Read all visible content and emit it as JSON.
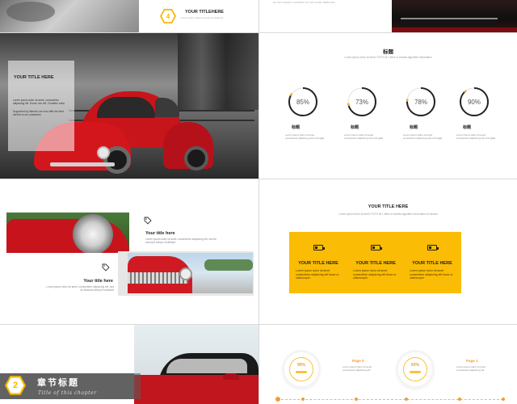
{
  "slide1": {
    "number": "4",
    "title": "YOUR TITLEHERE",
    "body": "Lorem ipsum dolor sit amet consectetur"
  },
  "slide2": {
    "body": "DO NOT MODIFY CONTENT IN THIS SLIDE TEMPLATE"
  },
  "slide3": {
    "title": "YOUR TITLE HERE",
    "body1": "Lorem ipsum dolor sit amet, consectetur adipiscing elit. Donec nec elit. Curabitur nulla",
    "body2": "Supported by Internet, we now offer the best service to our customers"
  },
  "slide4": {
    "title": "标题",
    "subtitle": "Lorem ipsum dolor sit amet, PUTH IN 1 titles of models algorithm information",
    "rings": [
      {
        "value": "85%",
        "pct": 85,
        "label": "标题",
        "body": "Lorem ipsum dolor sit amet consectetur adipiscing elit et fringilla"
      },
      {
        "value": "73%",
        "pct": 73,
        "label": "标题",
        "body": "Lorem ipsum dolor sit amet consectetur adipiscing elit et fringilla"
      },
      {
        "value": "78%",
        "pct": 78,
        "label": "标题",
        "body": "Lorem ipsum dolor sit amet consectetur adipiscing elit et fringilla"
      },
      {
        "value": "90%",
        "pct": 90,
        "label": "标题",
        "body": "Lorem ipsum dolor sit amet consectetur adipiscing elit et fringilla"
      }
    ],
    "accent": "#f6b800"
  },
  "slide5": {
    "item1_title": "Your title here",
    "item1_body": "Lorem ipsum dolor sit amet, consectetur adipiscing elit, sed do eiusmod tempor incididunt",
    "item2_title": "Your title here",
    "item2_body": "Lorem ipsum dolor sit amet, consectetur adipiscing elit, sed do eiusmod tempor incididunt"
  },
  "slide6": {
    "title": "YOUR TITLE HERE",
    "subtitle": "Lorem ipsum dolor sit amet, PUTH IN 1 titles of models algorithm information of stream",
    "cards": [
      {
        "title": "YOUR TITLE HERE",
        "body": "Lorem ipsum dolor sit amet consectetur adipiscing elit fusce ut ullamcorper"
      },
      {
        "title": "YOUR TITLE HERE",
        "body": "Lorem ipsum dolor sit amet consectetur adipiscing elit fusce ut ullamcorper"
      },
      {
        "title": "YOUR TITLE HERE",
        "body": "Lorem ipsum dolor sit amet consectetur adipiscing elit fusce ut ullamcorper"
      }
    ],
    "card_color": "#fbbc05"
  },
  "slide7": {
    "number": "2",
    "title_cn": "章节标题",
    "title_en": "Title of this chapter"
  },
  "slide8": {
    "items": [
      {
        "value": "90%",
        "page": "Page 0",
        "body": "Lorem ipsum dolor sit amet consectetur adipiscing elit"
      },
      {
        "value": "60%",
        "page": "Page 1",
        "body": "Lorem ipsum dolor sit amet consectetur adipiscing elit"
      }
    ]
  }
}
